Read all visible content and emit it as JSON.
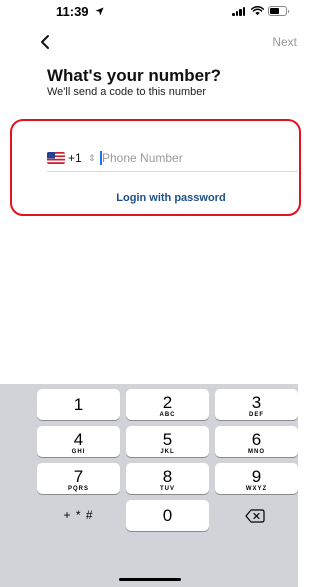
{
  "status_bar": {
    "time": "11:39"
  },
  "nav": {
    "next_label": "Next"
  },
  "header": {
    "title": "What's your number?",
    "subtitle": "We'll send a code to this number"
  },
  "phone": {
    "country_code": "+1",
    "placeholder": "Phone Number",
    "value": ""
  },
  "login_link": "Login with password",
  "keypad": {
    "keys": [
      {
        "digit": "1",
        "letters": ""
      },
      {
        "digit": "2",
        "letters": "ABC"
      },
      {
        "digit": "3",
        "letters": "DEF"
      },
      {
        "digit": "4",
        "letters": "GHI"
      },
      {
        "digit": "5",
        "letters": "JKL"
      },
      {
        "digit": "6",
        "letters": "MNO"
      },
      {
        "digit": "7",
        "letters": "PQRS"
      },
      {
        "digit": "8",
        "letters": "TUV"
      },
      {
        "digit": "9",
        "letters": "WXYZ"
      }
    ],
    "symbols_label": "+ * #",
    "zero": "0"
  },
  "colors": {
    "highlight": "#e2131c",
    "link": "#1e4f8b",
    "keyboard_bg": "#d1d3d9"
  }
}
